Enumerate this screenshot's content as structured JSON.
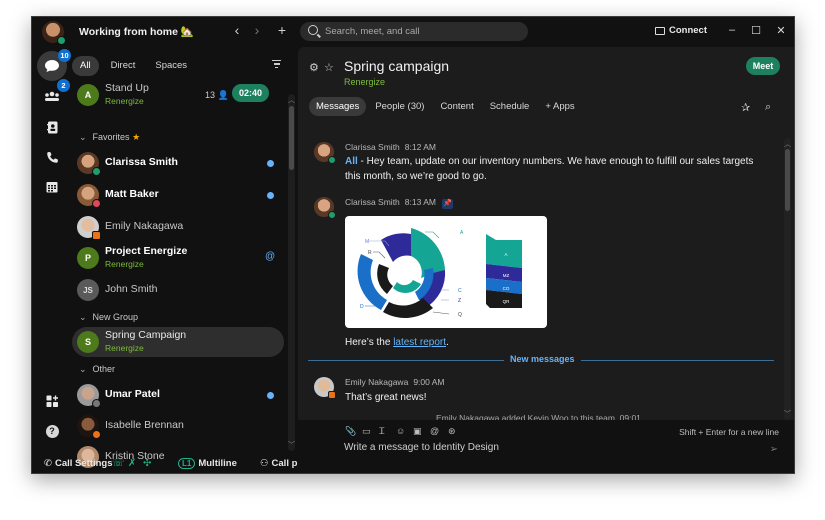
{
  "titlebar": {
    "status": "Working from home 🏡",
    "nav_back": "‹",
    "nav_forward": "›",
    "new": "+",
    "search_placeholder": "Search, meet, and call",
    "connect_label": "Connect",
    "minimize": "–",
    "maximize": "☐",
    "close": "✕"
  },
  "rail": {
    "messaging_badge": "10",
    "teams_badge": "2"
  },
  "list": {
    "filters": [
      "All",
      "Direct",
      "Spaces"
    ],
    "active_filter": "All",
    "standup": {
      "initial": "A",
      "name": "Stand Up",
      "team": "Renergize",
      "participants": "13",
      "timer": "02:40"
    },
    "favorites_label": "Favorites",
    "favorites_star": "★",
    "favorites": [
      {
        "name": "Clarissa Smith",
        "bold": true,
        "presence": "online",
        "unread": true
      },
      {
        "name": "Matt Baker",
        "bold": true,
        "presence": "dnd",
        "unread": true
      },
      {
        "name": "Emily Nakagawa",
        "bold": false,
        "presence": "meeting",
        "unread": false
      }
    ],
    "project": {
      "initial": "P",
      "name": "Project Energize",
      "team": "Renergize",
      "mention": "@"
    },
    "john": {
      "initials": "JS",
      "name": "John Smith"
    },
    "new_group_label": "New Group",
    "spring": {
      "initial": "S",
      "name": "Spring Campaign",
      "team": "Renergize"
    },
    "other_label": "Other",
    "other": [
      {
        "name": "Umar Patel",
        "bold": true,
        "presence": "away",
        "unread": true
      },
      {
        "name": "Isabelle Brennan",
        "bold": false,
        "presence": "call",
        "unread": false
      },
      {
        "name": "Kristin Stone",
        "bold": false,
        "presence": "none",
        "unread": false
      }
    ]
  },
  "bottombar": {
    "call_settings": "Call Settings",
    "line_badge": "L1",
    "multiline": "Multiline",
    "call_pickup": "Call pickup"
  },
  "space": {
    "title": "Spring campaign",
    "team": "Renergize",
    "meet_label": "Meet",
    "tabs": [
      "Messages",
      "People (30)",
      "Content",
      "Schedule",
      "+  Apps"
    ],
    "active_tab": "Messages"
  },
  "messages": [
    {
      "author": "Clarissa Smith",
      "time": "8:12 AM",
      "mention": "All",
      "text": " - Hey team, update on our inventory numbers. We have enough to fulfill our sales targets this month, so we’re good to go."
    },
    {
      "author": "Clarissa Smith",
      "time": "8:13 AM",
      "pinned": true,
      "text_before": "Here’s the ",
      "link": "latest report",
      "text_after": "."
    },
    {
      "author": "Emily Nakagawa",
      "time": "9:00 AM",
      "text": "That’s great news!"
    }
  ],
  "report_image": {
    "radial_labels": [
      "M",
      "R",
      "D",
      "A",
      "C",
      "Z",
      "Q"
    ],
    "stack_labels": [
      "A",
      "MZ",
      "CO",
      "QR"
    ],
    "colors": {
      "teal": "#14a595",
      "indigo": "#2e2a9a",
      "blue": "#1a6fc8",
      "black": "#1a1a1a"
    }
  },
  "new_messages_label": "New messages",
  "system_message": "Emily Nakagawa added Kevin Woo to this team. 09:01",
  "composer": {
    "hint": "Shift + Enter for a new line",
    "placeholder": "Write a message to Identity Design"
  },
  "colors": {
    "accent_green": "#1d805f",
    "team_green": "#7dbb3a",
    "unread_blue": "#64b4fa",
    "badge_blue": "#1170cf"
  }
}
